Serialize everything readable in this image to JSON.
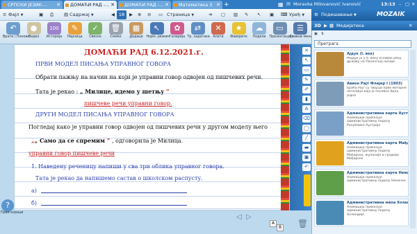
{
  "tabs": [
    {
      "label": "СРПСКИ ЈЕЗИК-...",
      "active": false
    },
    {
      "label": "ДОМАЋИ РАД -...",
      "active": true
    },
    {
      "label": "ДОМАЋИ РАД -...",
      "active": false
    },
    {
      "label": "Математика 3",
      "active": false
    }
  ],
  "user": {
    "name": "Moravka Milovanović Ivanović",
    "time": "13:13"
  },
  "toolbar1": {
    "file": "Фајл",
    "content": "Садржај",
    "page_number": "18",
    "page_label": "Страница",
    "devices": "Уређ",
    "settings": "Подешавање",
    "brand": "MOZAIK"
  },
  "tools": [
    {
      "name": "back-tool",
      "label": "Врати / Поново",
      "color": "#6d9ecf",
      "glyph": "↶"
    },
    {
      "name": "video-tool",
      "label": "Видео",
      "color": "#cfc5a4",
      "glyph": "●"
    },
    {
      "name": "history-tool",
      "label": "Историја",
      "color": "#9b82c9",
      "glyph": "100"
    },
    {
      "name": "pen-tool",
      "label": "Перница",
      "color": "#e9a23b",
      "glyph": "✎"
    },
    {
      "name": "eraser-tool",
      "label": "Свеске",
      "color": "#7fb36a",
      "glyph": "✓"
    },
    {
      "name": "delete-tool",
      "label": "Смеће",
      "color": "#9aa3ad",
      "glyph": "🗑"
    },
    {
      "name": "add-tool",
      "label": "Додаци",
      "color": "#c79a62",
      "glyph": "▦"
    },
    {
      "name": "normal-mode-tool",
      "label": "Норм. режим",
      "color": "#4b79b8",
      "glyph": "↖"
    },
    {
      "name": "gallery-tool",
      "label": "Галерија",
      "color": "#d05a8c",
      "glyph": "✿"
    },
    {
      "name": "tasks-tool",
      "label": "Тр. задатака",
      "color": "#5f8dc4",
      "glyph": "⇄"
    },
    {
      "name": "tools-tool",
      "label": "Алати",
      "color": "#cf6a4e",
      "glyph": "✕"
    },
    {
      "name": "favorites-tool",
      "label": "Фаворите",
      "color": "#e7c233",
      "glyph": "★"
    },
    {
      "name": "share-tool",
      "label": "Подели",
      "color": "#8fb6da",
      "glyph": "☁"
    },
    {
      "name": "presentation-tool",
      "label": "Презентација",
      "color": "#6e8fb3",
      "glyph": "▭"
    },
    {
      "name": "main-menu-tool",
      "label": "Главни мени",
      "color": "#5679ac",
      "glyph": "☰"
    }
  ],
  "doc": {
    "title": "ДОМАЋИ РАД 6.12.2021.г.",
    "h1": "ПРВИ МОДЕЛ ПИСАЊА УПРАВНОГ ГОВОРА",
    "p1": "Обрати пажњу на начин на који је управни говор одвојен од пишчевих речи.",
    "p2a": "Тата је рекао : ",
    "p2b": "„ Милице, идемо у шетњу",
    "p2c": " ”",
    "p3": "пишчеве речи управни говор.",
    "h2": "ДРУГИ МОДЕЛ ПИСАЊА УПРАВНОГ ГОВОРА",
    "p4": "Погледај како је управни говор одвојен од пишчевих речи у другом моделу њего",
    "p5a": "„ Само да се спремим",
    "p5b": " ” ",
    "p5c": ", одговорила је Милица.",
    "p6": "управни говор пишчеве речи",
    "p7": "1. Наведену реченицу напиши у сва три облика управног говора.",
    "p8": "Тата је рекао да напишемо састав о школском распусту.",
    "a": "а)",
    "b": "б)"
  },
  "help": {
    "label": "Први кораци"
  },
  "panel": {
    "title": "Медијатека",
    "search_placeholder": "Претрага",
    "items": [
      {
        "title": "Ајдук (I. век)",
        "desc": "Мајдук је у 9. веку основао реку државу на Панонској низији",
        "color": "#b8893a"
      },
      {
        "title": "Авион Рајт Флајер I (1903)",
        "desc": "Браћа Рајт су творци прве моторне летелице која је посебно била једна",
        "color": "#7e9cb8"
      },
      {
        "title": "Административна карта Аустрије",
        "desc": "Анимација приказује административну поделу Републике Аустрије",
        "color": "#7aa0c8"
      },
      {
        "title": "Административна карта Мађарске",
        "desc": "Анимација приказује административну поделу Мађарске, жупаније и градове Мађарске",
        "color": "#e0a21e"
      },
      {
        "title": "Административна карта Немачке",
        "desc": "Анимација приказује административну поделу Немачке",
        "color": "#5f9f4a"
      },
      {
        "title": "Административна мапа Холандије",
        "desc": "Анимација приказује административну поделу Холандије",
        "color": "#4a8bb5"
      }
    ]
  }
}
